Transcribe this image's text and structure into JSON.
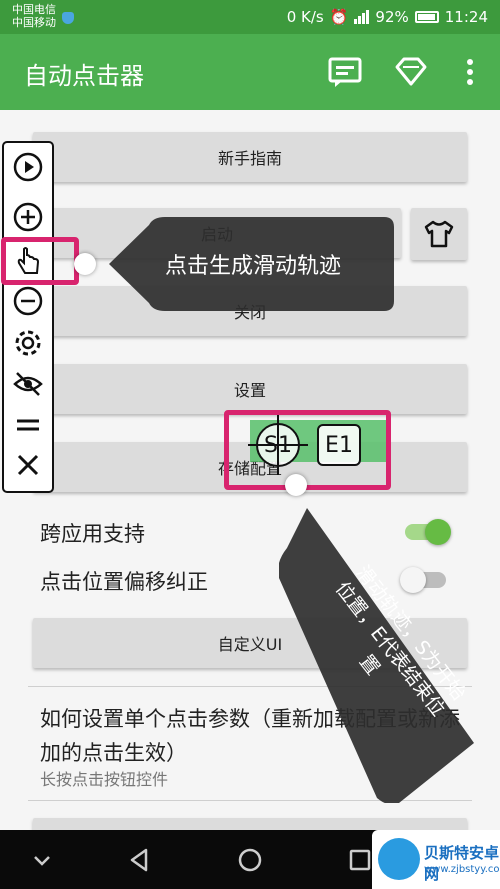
{
  "status": {
    "carrier1": "中国电信",
    "carrier2": "中国移动",
    "speed": "0 K/s",
    "battery": "92%",
    "battery_level": 0.92,
    "time": "11:24"
  },
  "appbar": {
    "title": "自动点击器",
    "icons": [
      "chat-icon",
      "diamond-icon",
      "more-vert-icon"
    ]
  },
  "buttons": {
    "guide": "新手指南",
    "start": "启动",
    "stop": "关闭",
    "settings": "设置",
    "save_config": "存储配置",
    "custom_ui": "自定义UI"
  },
  "settings_rows": [
    {
      "label": "跨应用支持",
      "on": true
    },
    {
      "label": "点击位置偏移纠正",
      "on": false
    }
  ],
  "help_item": {
    "title": "如何设置单个点击参数（重新加载配置或新添加的点击生效）",
    "subtitle": "长按点击按钮控件"
  },
  "floating_toolbar": [
    "play-icon",
    "add-icon",
    "swipe-pointer-icon",
    "remove-icon",
    "settings-gear-icon",
    "hide-eye-icon",
    "drag-handle-icon",
    "close-icon"
  ],
  "annotations": {
    "tooltip1": "点击生成滑动轨迹",
    "tooltip2": "滑动轨迹，S为开始位置，E代表结束位置"
  },
  "swipe_markers": {
    "start": "S1",
    "end": "E1"
  },
  "watermark": {
    "name": "贝斯特安卓网",
    "url": "www.zjbstyy.com"
  },
  "colors": {
    "status_bar": "#3d9a3d",
    "app_bar": "#4caf50",
    "highlight": "#d8246e",
    "switch_on": "#66bb44",
    "tooltip_bg": "#2e2e2e"
  }
}
